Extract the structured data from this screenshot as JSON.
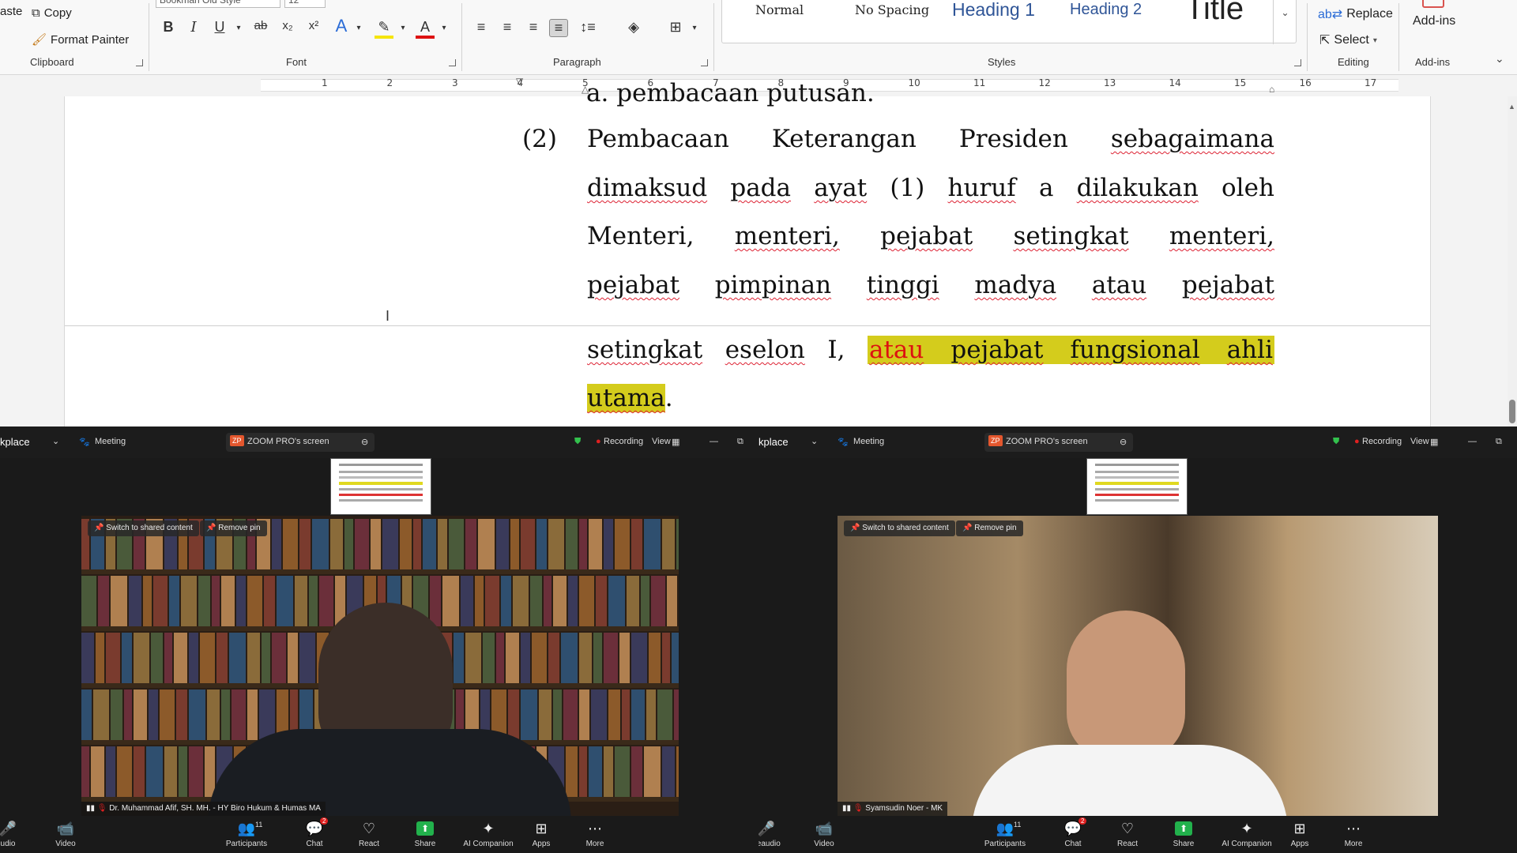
{
  "word": {
    "clipboard": {
      "paste_label": "aste",
      "copy_label": "Copy",
      "format_painter_label": "Format Painter",
      "group_label": "Clipboard"
    },
    "font": {
      "font_name": "Bookman Old Style",
      "font_size": "12",
      "group_label": "Font"
    },
    "paragraph": {
      "group_label": "Paragraph"
    },
    "styles": {
      "items": [
        "Normal",
        "No Spacing",
        "Heading 1",
        "Heading 2",
        "Title"
      ],
      "group_label": "Styles"
    },
    "editing": {
      "replace_label": "Replace",
      "select_label": "Select",
      "group_label": "Editing"
    },
    "addins": {
      "label": "Add-ins",
      "group_label": "Add-ins"
    },
    "ruler_numbers": [
      "1",
      "2",
      "3",
      "4",
      "5",
      "6",
      "7",
      "8",
      "9",
      "10",
      "11",
      "12",
      "13",
      "14",
      "15",
      "16",
      "17"
    ],
    "document": {
      "item_number": "(2)",
      "top_fragment": "a. pembacaan putusan.",
      "lines": [
        [
          "Pembacaan",
          "Keterangan",
          "Presiden",
          "sebagaimana"
        ],
        [
          "dimaksud",
          "pada",
          "ayat",
          "(1)",
          "huruf",
          "a",
          "dilakukan",
          "oleh"
        ],
        [
          "Menteri,",
          "menteri,",
          "pejabat",
          "setingkat",
          "menteri,"
        ],
        [
          "pejabat",
          "pimpinan",
          "tinggi",
          "madya",
          "atau",
          "pejabat"
        ]
      ],
      "line5_plain": [
        "setingkat",
        "eselon",
        "I,"
      ],
      "line5_highlight": [
        "atau",
        "pejabat",
        "fungsional",
        "ahli"
      ],
      "line6_highlight": "utama",
      "line6_end": "."
    }
  },
  "zoom_windows": [
    {
      "workplace": "kplace",
      "meeting_label": "Meeting",
      "screen_label": "ZOOM PRO's screen",
      "recording_label": "Recording",
      "view_label": "View",
      "switch_label": "Switch to shared content",
      "remove_pin_label": "Remove pin",
      "participant_name": "Dr. Muhammad Afif, SH. MH. - HY Biro Hukum & Humas MA",
      "toolbar": [
        "udio",
        "Video",
        "Participants",
        "Chat",
        "React",
        "Share",
        "AI Companion",
        "Apps",
        "More"
      ],
      "participants_count": "11",
      "chat_badge": "2"
    },
    {
      "workplace": "kplace",
      "meeting_label": "Meeting",
      "screen_label": "ZOOM PRO's screen",
      "recording_label": "Recording",
      "view_label": "View",
      "switch_label": "Switch to shared content",
      "remove_pin_label": "Remove pin",
      "participant_name": "Syamsudin Noer - MK",
      "toolbar": [
        "Leaudio",
        "Video",
        "Participants",
        "Chat",
        "React",
        "Share",
        "AI Companion",
        "Apps",
        "More"
      ],
      "participants_count": "11",
      "chat_badge": "2"
    }
  ],
  "colors": {
    "highlight": "#d4cc1c",
    "recording": "#e02020",
    "share_green": "#22b14c",
    "heading_blue": "#2f5597"
  }
}
